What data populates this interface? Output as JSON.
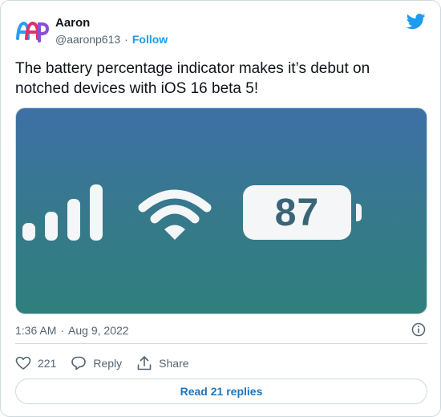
{
  "author": {
    "name": "Aaron",
    "handle": "@aaronp613",
    "separator": "·",
    "follow_label": "Follow"
  },
  "tweet": {
    "text": "The battery percentage indicator makes it’s debut on notched devices with iOS 16 beta 5!"
  },
  "media": {
    "battery_percentage": "87",
    "signal_bars": 4,
    "wifi_strength": "full"
  },
  "meta": {
    "time": "1:36 AM",
    "separator": "·",
    "date": "Aug 9, 2022"
  },
  "actions": {
    "like_count": "221",
    "reply_label": "Reply",
    "share_label": "Share"
  },
  "read_replies_label": "Read 21 replies",
  "icons": {
    "avatar": "ap-logo",
    "brand": "twitter-bird-icon",
    "info": "info-icon",
    "like": "heart-icon",
    "reply": "reply-bubble-icon",
    "share": "share-icon"
  },
  "colors": {
    "accent": "#1d9bf0",
    "link": "#1d75bd",
    "text": "#0f1419",
    "secondary_text": "#536471",
    "border": "#cfd9de",
    "media_top": "#3e6fa6",
    "media_bottom": "#2f7f7c",
    "battery_text": "#3b6476"
  }
}
